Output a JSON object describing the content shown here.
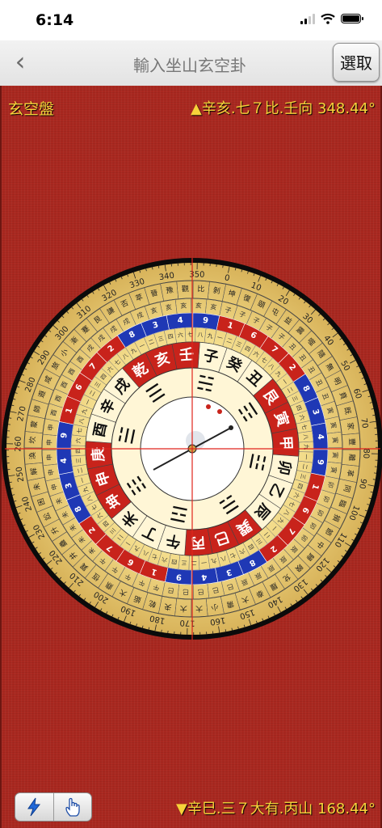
{
  "status_bar": {
    "time": "6:14"
  },
  "nav": {
    "back_glyph": "‹",
    "title": "輸入坐山玄空卦",
    "select_label": "選取"
  },
  "board": {
    "label": "玄空盤",
    "top_reading": "▲辛亥.七７比.壬向 348.44°",
    "bottom_reading": "▼辛巳.三７大有.丙山 168.44°",
    "rotation_deg": 11.56
  },
  "compass": {
    "degree_labels": [
      "0",
      "10",
      "20",
      "30",
      "40",
      "50",
      "60",
      "70",
      "80",
      "90",
      "100",
      "110",
      "120",
      "130",
      "140",
      "150",
      "160",
      "170",
      "180",
      "190",
      "200",
      "210",
      "220",
      "230",
      "240",
      "250",
      "260",
      "270",
      "280",
      "290",
      "300",
      "310",
      "320",
      "330",
      "340",
      "350"
    ],
    "mountains": [
      "子",
      "癸",
      "丑",
      "艮",
      "寅",
      "甲",
      "卯",
      "乙",
      "辰",
      "巽",
      "巳",
      "丙",
      "午",
      "丁",
      "未",
      "坤",
      "申",
      "庚",
      "酉",
      "辛",
      "戌",
      "乾",
      "亥",
      "壬"
    ],
    "mountain_colors": [
      "black",
      "black",
      "black",
      "red",
      "red",
      "red",
      "black",
      "black",
      "black",
      "red",
      "red",
      "red",
      "black",
      "black",
      "black",
      "red",
      "red",
      "red",
      "black",
      "black",
      "black",
      "red",
      "red",
      "red"
    ],
    "trigrams": [
      "☵",
      "☶",
      "☳",
      "☴",
      "☲",
      "☷",
      "☱",
      "☰"
    ],
    "star_numbers": [
      "1",
      "6",
      "7",
      "2",
      "8",
      "3",
      "4",
      "9",
      "1",
      "6",
      "7",
      "2",
      "8",
      "3",
      "4",
      "9",
      "1",
      "6",
      "7",
      "2",
      "8",
      "3",
      "4",
      "9",
      "1",
      "6",
      "7",
      "2",
      "8",
      "3",
      "4",
      "9"
    ],
    "ring_cells": [
      "甲子",
      "丙子",
      "戊子",
      "庚子",
      "壬子",
      "乙丑",
      "丁丑",
      "己丑",
      "辛丑",
      "癸丑",
      "丙寅",
      "戊寅",
      "庚寅",
      "壬寅",
      "甲寅",
      "丁卯",
      "己卯",
      "辛卯",
      "癸卯",
      "乙卯",
      "戊辰",
      "庚辰",
      "壬辰",
      "甲辰",
      "丙辰",
      "己巳",
      "辛巳",
      "癸巳",
      "乙巳",
      "丁巳",
      "庚午",
      "壬午",
      "甲午",
      "丙午",
      "戊午",
      "辛未",
      "癸未",
      "乙未",
      "丁未",
      "己未",
      "壬申",
      "甲申",
      "丙申",
      "戊申",
      "庚申",
      "癸酉",
      "乙酉",
      "丁酉",
      "己酉",
      "辛酉",
      "甲戌",
      "丙戌",
      "戊戌",
      "庚戌",
      "壬戌",
      "乙亥",
      "丁亥",
      "己亥",
      "辛亥",
      "癸亥"
    ],
    "hexagrams": [
      "坤",
      "復",
      "頤",
      "屯",
      "益",
      "震",
      "噬嗑",
      "隨",
      "無妄",
      "明夷",
      "賁",
      "既濟",
      "家人",
      "豐",
      "離",
      "革",
      "同人",
      "臨",
      "損",
      "節",
      "中孚",
      "歸妹",
      "睽",
      "兌",
      "履",
      "泰",
      "大畜",
      "需",
      "小畜",
      "大壯",
      "大有",
      "夬",
      "乾",
      "姤",
      "大過",
      "鼎",
      "恆",
      "巽",
      "井",
      "蠱",
      "升",
      "訟",
      "困",
      "未濟",
      "解",
      "渙",
      "坎",
      "蒙",
      "師",
      "遯",
      "咸",
      "旅",
      "小過",
      "漸",
      "蹇",
      "艮",
      "謙",
      "否",
      "萃",
      "晉",
      "豫",
      "觀",
      "比",
      "剝"
    ],
    "small_digits": [
      "一",
      "二",
      "三",
      "四",
      "六",
      "七",
      "八",
      "九"
    ]
  }
}
